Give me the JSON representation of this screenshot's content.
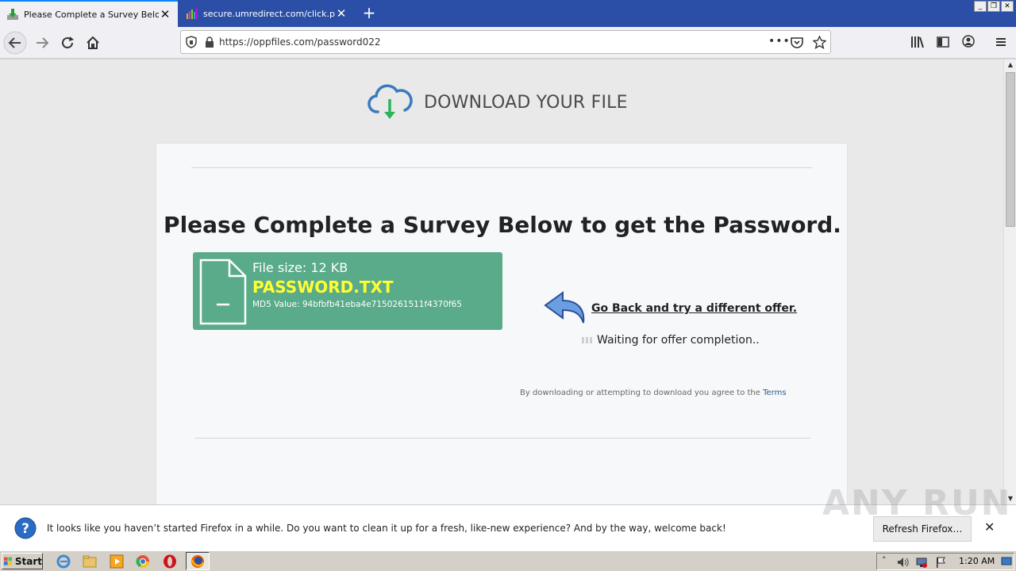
{
  "browser": {
    "tabs": [
      {
        "title": "Please Complete a Survey Below t",
        "active": true,
        "favicon": "download-icon"
      },
      {
        "title": "secure.umredirect.com/click.php?j",
        "active": false,
        "favicon": "bar-chart-icon"
      }
    ],
    "url": "https://oppfiles.com/password022"
  },
  "page": {
    "header_text": "DOWNLOAD YOUR FILE",
    "headline": "Please Complete a Survey Below to get the Password.",
    "file": {
      "size": "File size: 12 KB",
      "name": "PASSWORD.TXT",
      "md5": "MD5 Value: 94bfbfb41eba4e7150261511f4370f65"
    },
    "go_back": "Go Back and try a different offer.",
    "waiting": "Waiting for offer completion..",
    "terms_prefix": "By downloading or attempting to download you agree to the ",
    "terms_link": "Terms"
  },
  "notification": {
    "text": "It looks like you haven’t started Firefox in a while. Do you want to clean it up for a fresh, like-new experience? And by the way, welcome back!",
    "button": "Refresh Firefox…",
    "watermark": "ANY RUN"
  },
  "taskbar": {
    "start_label": "Start",
    "clock": "1:20 AM"
  },
  "colors": {
    "file_box": "#5aab8a",
    "file_name": "#ffff33",
    "tab_bar": "#2b4fa6"
  }
}
